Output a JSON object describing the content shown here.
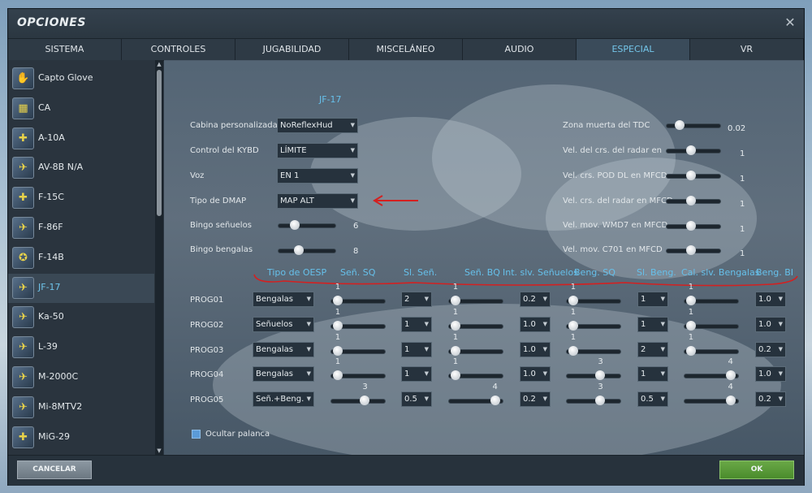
{
  "window": {
    "title": "OPCIONES",
    "close_symbol": "✕"
  },
  "tabs": [
    "SISTEMA",
    "CONTROLES",
    "JUGABILIDAD",
    "MISCELÁNEO",
    "AUDIO",
    "ESPECIAL",
    "VR"
  ],
  "active_tab": "ESPECIAL",
  "sidebar": {
    "items": [
      {
        "label": "Capto Glove",
        "icon": "capto-glove-icon"
      },
      {
        "label": "CA",
        "icon": "ca-icon"
      },
      {
        "label": "A-10A",
        "icon": "a10a-icon"
      },
      {
        "label": "AV-8B N/A",
        "icon": "av8b-icon"
      },
      {
        "label": "F-15C",
        "icon": "f15c-icon"
      },
      {
        "label": "F-86F",
        "icon": "f86f-icon"
      },
      {
        "label": "F-14B",
        "icon": "f14b-icon"
      },
      {
        "label": "JF-17",
        "icon": "jf17-icon"
      },
      {
        "label": "Ka-50",
        "icon": "ka50-icon"
      },
      {
        "label": "L-39",
        "icon": "l39-icon"
      },
      {
        "label": "M-2000C",
        "icon": "m2000c-icon"
      },
      {
        "label": "Mi-8MTV2",
        "icon": "mi8-icon"
      },
      {
        "label": "MiG-29",
        "icon": "mig29-icon"
      }
    ],
    "selected": "JF-17"
  },
  "main": {
    "section_title": "JF-17",
    "left_settings": {
      "cabina": {
        "label": "Cabina personalizada",
        "value": "NoReflexHud"
      },
      "kybd": {
        "label": "Control del KYBD",
        "value": "LÍMITE"
      },
      "voz": {
        "label": "Voz",
        "value": "EN 1"
      },
      "dmap": {
        "label": "Tipo de DMAP",
        "value": "MAP ALT"
      },
      "bingo_senuelos": {
        "label": "Bingo señuelos",
        "value": "6",
        "fraction": 0.25
      },
      "bingo_bengalas": {
        "label": "Bingo bengalas",
        "value": "8",
        "fraction": 0.33
      }
    },
    "right_settings": {
      "tdc": {
        "label": "Zona muerta del TDC",
        "value": "0.02",
        "fraction": 0.2
      },
      "radar_hud": {
        "label": "Vel. del crs. del radar en HU",
        "value": "1",
        "fraction": 0.45
      },
      "pod": {
        "label": "Vel. crs. POD DL en MFCD",
        "value": "1",
        "fraction": 0.45
      },
      "radar_mfcd": {
        "label": "Vel. crs. del radar en MFCD",
        "value": "1",
        "fraction": 0.45
      },
      "wmd7": {
        "label": "Vel. mov. WMD7 en MFCD",
        "value": "1",
        "fraction": 0.45
      },
      "c701": {
        "label": "Vel. mov. C701 en MFCD",
        "value": "1",
        "fraction": 0.45
      }
    },
    "table_headers": [
      "Tipo de OESP",
      "Señ. SQ",
      "Sl. Señ.",
      "Señ. BQ",
      "Int. slv. Señuelos",
      "Beng. SQ",
      "Sl. Beng.",
      "Cal. slv. Bengalas",
      "Beng. BI"
    ],
    "programs": [
      {
        "name": "PROG01",
        "tipo": "Bengalas",
        "sen_sq": "1",
        "sen_sq_f": 0.05,
        "sl_sen": "2",
        "sen_bq": "1",
        "sen_bq_f": 0.05,
        "int": "0.2",
        "beng_sq": "1",
        "beng_sq_f": 0.05,
        "sl_beng": "1",
        "cal_bq": "1",
        "cal_bq_f": 0.05,
        "beng_bi": "1.0"
      },
      {
        "name": "PROG02",
        "tipo": "Señuelos",
        "sen_sq": "1",
        "sen_sq_f": 0.05,
        "sl_sen": "1",
        "sen_bq": "1",
        "sen_bq_f": 0.05,
        "int": "1.0",
        "beng_sq": "1",
        "beng_sq_f": 0.05,
        "sl_beng": "1",
        "cal_bq": "1",
        "cal_bq_f": 0.05,
        "beng_bi": "1.0"
      },
      {
        "name": "PROG03",
        "tipo": "Bengalas",
        "sen_sq": "1",
        "sen_sq_f": 0.05,
        "sl_sen": "1",
        "sen_bq": "1",
        "sen_bq_f": 0.05,
        "int": "1.0",
        "beng_sq": "1",
        "beng_sq_f": 0.05,
        "sl_beng": "2",
        "cal_bq": "1",
        "cal_bq_f": 0.05,
        "beng_bi": "0.2"
      },
      {
        "name": "PROG04",
        "tipo": "Bengalas",
        "sen_sq": "1",
        "sen_sq_f": 0.05,
        "sl_sen": "1",
        "sen_bq": "1",
        "sen_bq_f": 0.05,
        "int": "1.0",
        "beng_sq": "3",
        "beng_sq_f": 0.65,
        "sl_beng": "1",
        "cal_bq": "4",
        "cal_bq_f": 0.92,
        "beng_bi": "1.0"
      },
      {
        "name": "PROG05",
        "tipo": "Señ.+Beng.",
        "sen_sq": "3",
        "sen_sq_f": 0.65,
        "sl_sen": "0.5",
        "sen_bq": "4",
        "sen_bq_f": 0.92,
        "int": "0.2",
        "beng_sq": "3",
        "beng_sq_f": 0.65,
        "sl_beng": "0.5",
        "cal_bq": "4",
        "cal_bq_f": 0.92,
        "beng_bi": "0.2"
      }
    ],
    "ocultar_palanca": {
      "label": "Ocultar palanca",
      "checked": true
    }
  },
  "footer": {
    "cancel_label": "CANCELAR",
    "ok_label": "OK"
  },
  "colors": {
    "accent": "#66c0ea",
    "annotation": "#d42020",
    "ok": "#5a9a3a"
  }
}
